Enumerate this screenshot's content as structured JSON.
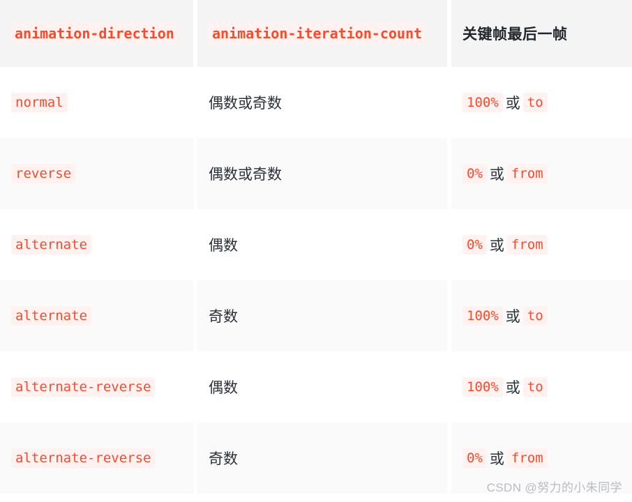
{
  "table": {
    "headers": [
      {
        "text": "animation-direction",
        "style": "code"
      },
      {
        "text": "animation-iteration-count",
        "style": "code"
      },
      {
        "text": "关键帧最后一帧",
        "style": "plain"
      }
    ],
    "rows": [
      {
        "direction": "normal",
        "count": "偶数或奇数",
        "frame_first": "100%",
        "frame_sep": "或",
        "frame_second": "to"
      },
      {
        "direction": "reverse",
        "count": "偶数或奇数",
        "frame_first": "0%",
        "frame_sep": "或",
        "frame_second": "from"
      },
      {
        "direction": "alternate",
        "count": "偶数",
        "frame_first": "0%",
        "frame_sep": "或",
        "frame_second": "from"
      },
      {
        "direction": "alternate",
        "count": "奇数",
        "frame_first": "100%",
        "frame_sep": "或",
        "frame_second": "to"
      },
      {
        "direction": "alternate-reverse",
        "count": "偶数",
        "frame_first": "100%",
        "frame_sep": "或",
        "frame_second": "to"
      },
      {
        "direction": "alternate-reverse",
        "count": "奇数",
        "frame_first": "0%",
        "frame_sep": "或",
        "frame_second": "from"
      }
    ]
  },
  "watermark": {
    "text": "CSDN @努力的小朱同学"
  },
  "colors": {
    "code_text": "#fa4a2c",
    "code_background": "#fff2f0",
    "header_background": "#f4f4f5",
    "row_background": "#ffffff",
    "row_alt_background": "#fafafa",
    "body_text": "#2c3038",
    "watermark_text": "#b9bcc2"
  }
}
